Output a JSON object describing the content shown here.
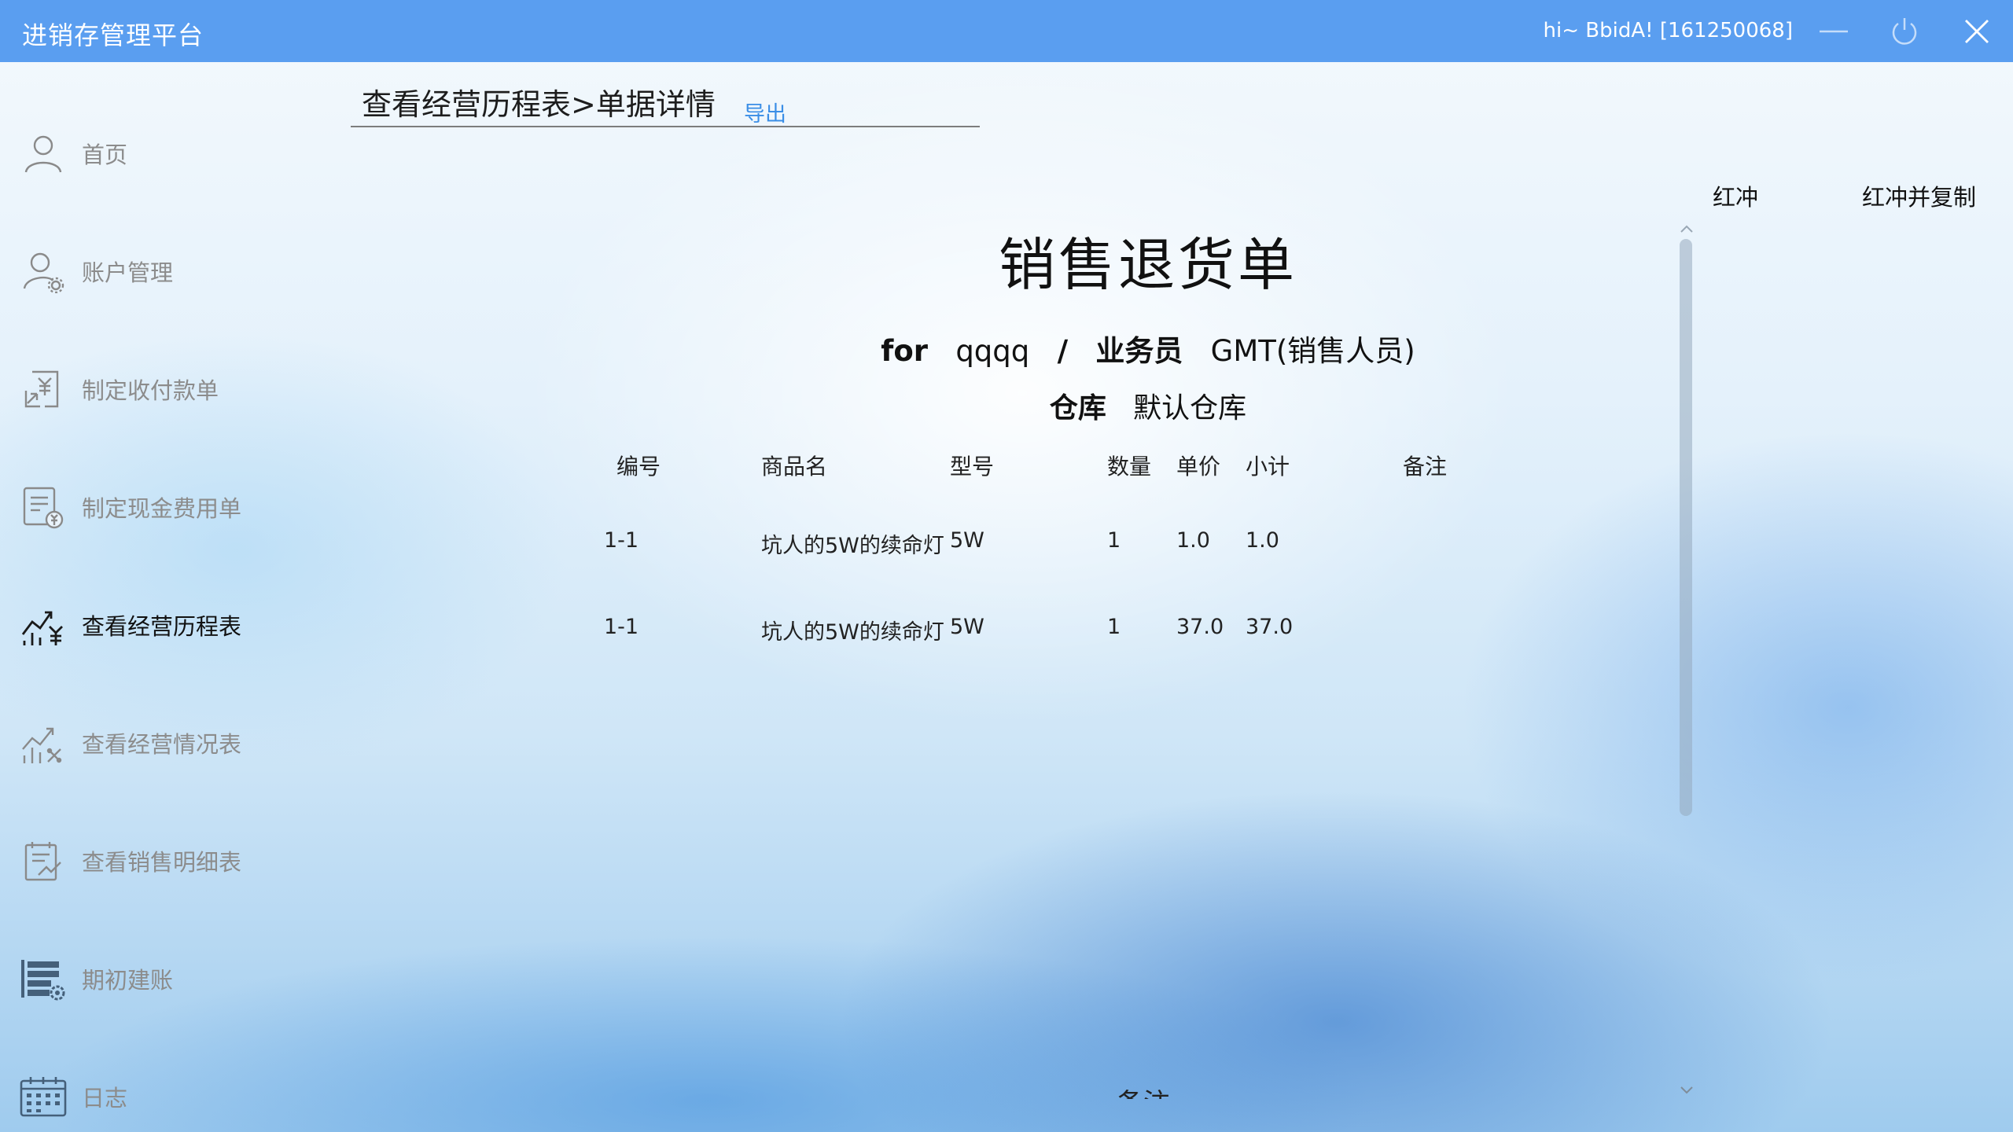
{
  "window": {
    "title": "进销存管理平台",
    "greeting": "hi~ BbidA! [161250068]"
  },
  "sidebar": {
    "items": [
      {
        "label": "首页",
        "icon": "user-icon",
        "active": false
      },
      {
        "label": "账户管理",
        "icon": "user-settings-icon",
        "active": false
      },
      {
        "label": "制定收付款单",
        "icon": "yuan-transfer-icon",
        "active": false
      },
      {
        "label": "制定现金费用单",
        "icon": "cash-expense-doc-icon",
        "active": false
      },
      {
        "label": "查看经营历程表",
        "icon": "trend-yuan-icon",
        "active": true
      },
      {
        "label": "查看经营情况表",
        "icon": "trend-chart-icon",
        "active": false
      },
      {
        "label": "查看销售明细表",
        "icon": "sales-detail-doc-icon",
        "active": false
      },
      {
        "label": "期初建账",
        "icon": "ledger-settings-icon",
        "active": false
      },
      {
        "label": "日志",
        "icon": "calendar-icon",
        "active": false
      }
    ]
  },
  "header": {
    "breadcrumb": "查看经营历程表>单据详情",
    "export_label": "导出"
  },
  "actions": {
    "red_label": "红冲",
    "red_copy_label": "红冲并复制"
  },
  "document": {
    "title": "销售退货单",
    "for_label": "for",
    "customer": "qqqq",
    "separator": "/",
    "salesman_label": "业务员",
    "salesman": "GMT(销售人员)",
    "warehouse_label": "仓库",
    "warehouse": "默认仓库",
    "columns": [
      "编号",
      "商品名",
      "型号",
      "数量",
      "单价",
      "小计",
      "备注"
    ],
    "rows": [
      [
        "1-1",
        "坑人的5W的续命灯",
        "5W",
        "1",
        "1.0",
        "1.0",
        ""
      ],
      [
        "1-1",
        "坑人的5W的续命灯",
        "5W",
        "1",
        "37.0",
        "37.0",
        ""
      ]
    ],
    "remark_label": "备注"
  },
  "colors": {
    "titlebar": "#5a9ef0",
    "link": "#3a8ee6",
    "inactive_text": "#8c8c8c"
  }
}
